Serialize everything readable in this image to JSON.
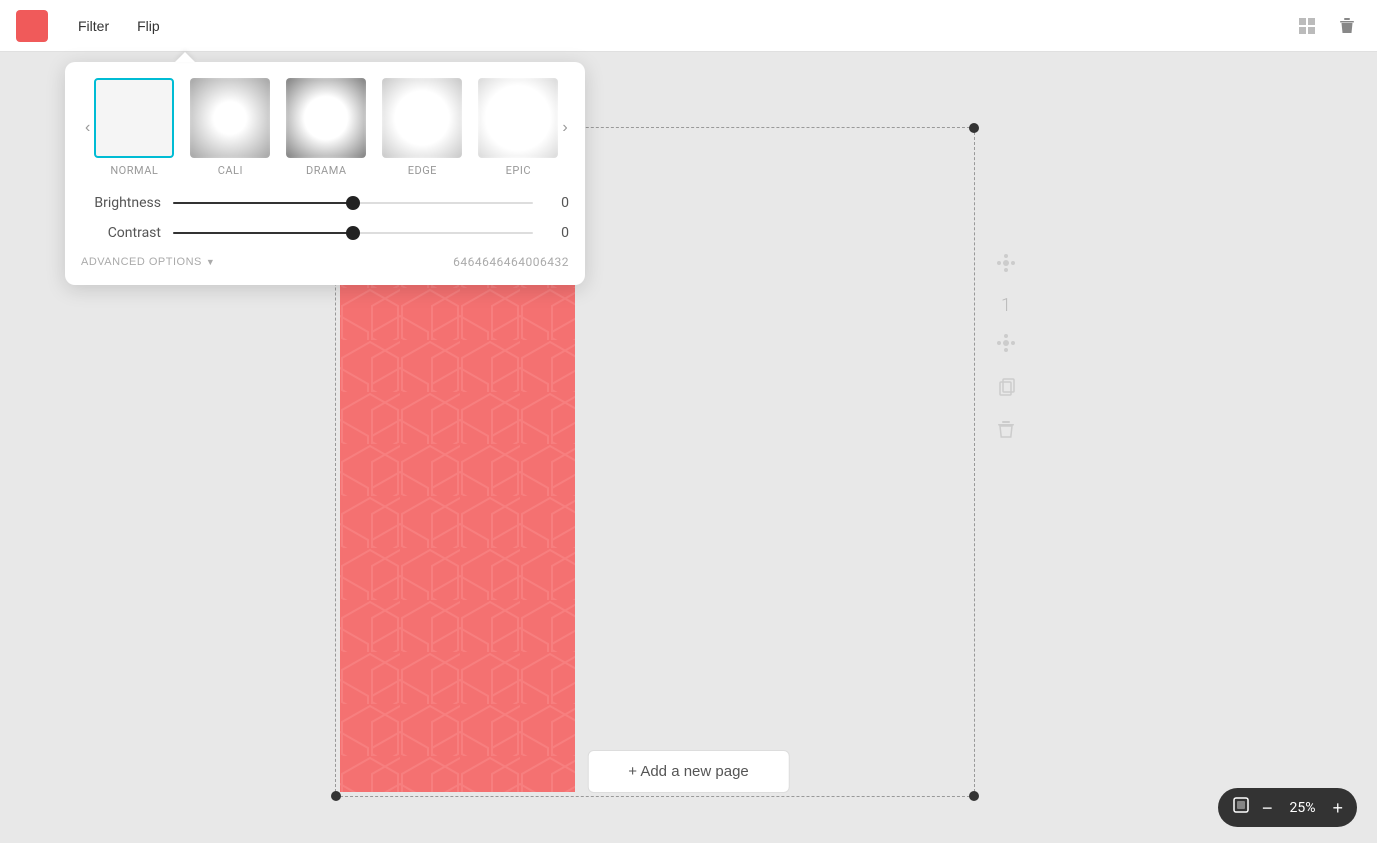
{
  "toolbar": {
    "filter_label": "Filter",
    "flip_label": "Flip"
  },
  "filter_popup": {
    "filters": [
      {
        "id": "normal",
        "label": "NORMAL",
        "active": true
      },
      {
        "id": "cali",
        "label": "CALI",
        "active": false
      },
      {
        "id": "drama",
        "label": "DRAMA",
        "active": false
      },
      {
        "id": "edge",
        "label": "EDGE",
        "active": false
      },
      {
        "id": "epic",
        "label": "EPIC",
        "active": false
      }
    ],
    "brightness": {
      "label": "Brightness",
      "value": 0,
      "position_pct": 50
    },
    "contrast": {
      "label": "Contrast",
      "value": 0,
      "position_pct": 50
    },
    "advanced_options_label": "ADVANCED OPTIONS",
    "filter_code": "6464646464006432"
  },
  "canvas": {
    "page_number": "1",
    "add_page_label": "+ Add a new page"
  },
  "zoom": {
    "level": "25%",
    "minus_label": "−",
    "plus_label": "+"
  }
}
